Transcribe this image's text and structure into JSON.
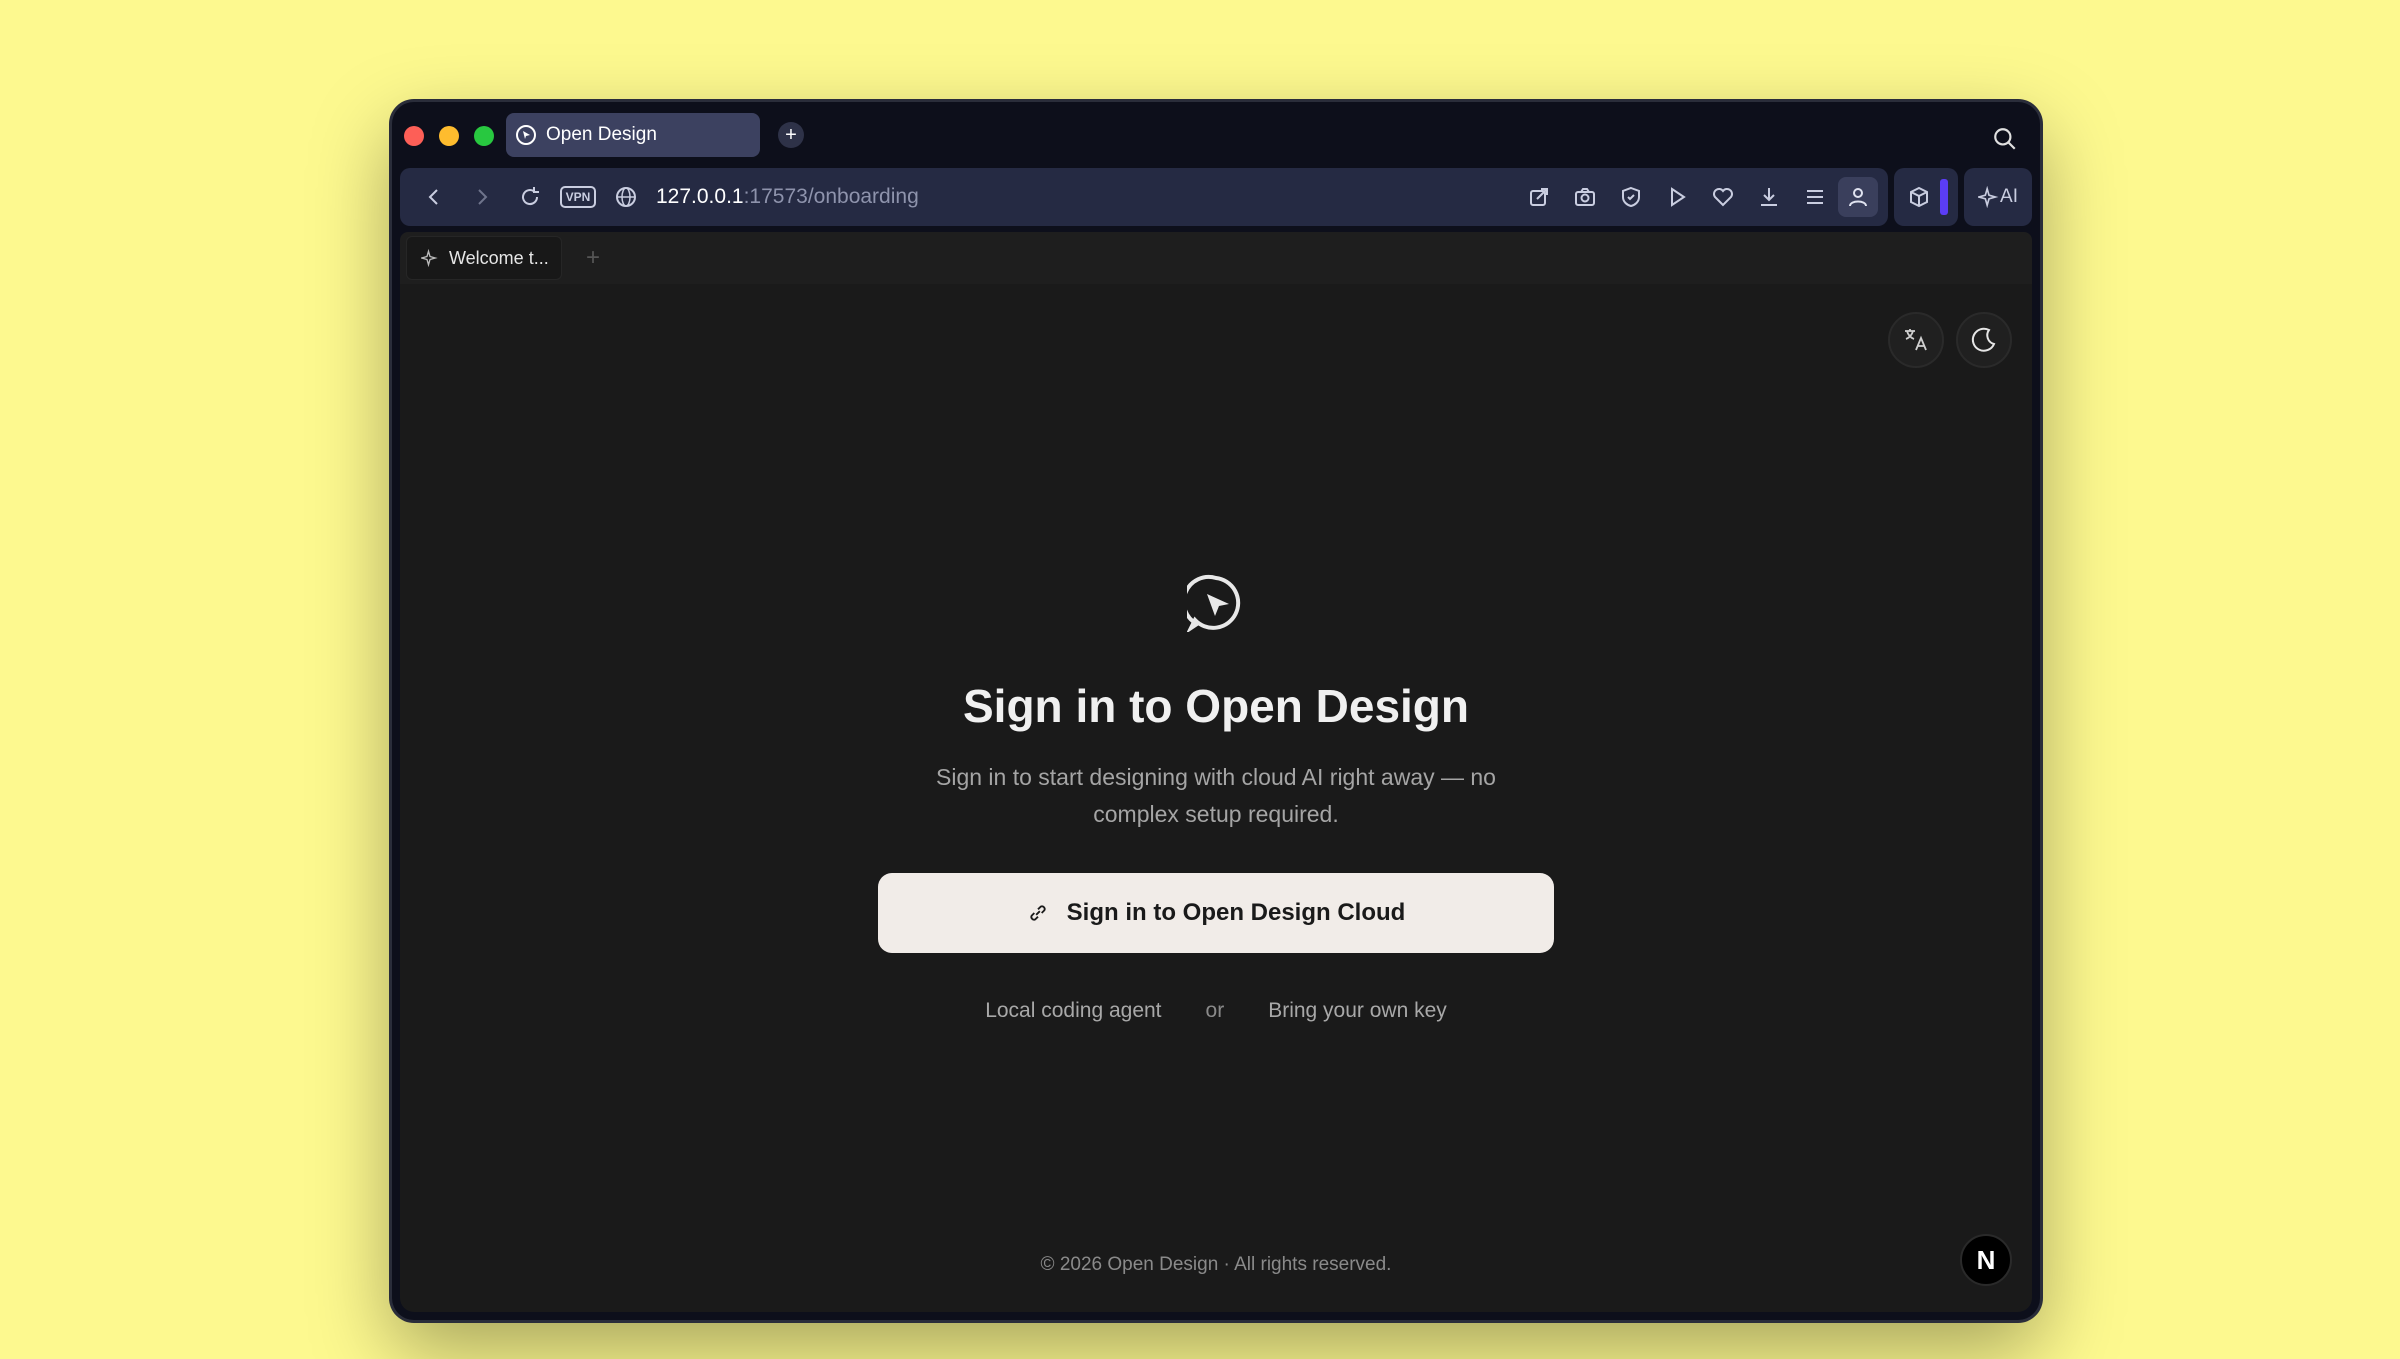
{
  "browser": {
    "tab_title": "Open Design",
    "url_host": "127.0.0.1",
    "url_path": ":17573/onboarding",
    "vpn_label": "VPN",
    "ai_label": "AI",
    "icons": [
      "back-icon",
      "forward-icon",
      "reload-icon",
      "globe-icon",
      "share-icon",
      "camera-icon",
      "shield-icon",
      "play-icon",
      "heart-icon",
      "download-icon",
      "menu-icon",
      "profile-icon",
      "cube-icon",
      "ai-sparkle-icon",
      "search-icon"
    ]
  },
  "inner_tab": {
    "label": "Welcome t...",
    "add_label": "+"
  },
  "onboarding": {
    "title": "Sign in to Open Design",
    "subtitle": "Sign in to start designing with cloud AI right away — no complex setup required.",
    "primary_button": "Sign in to Open Design Cloud",
    "alt_local": "Local coding agent",
    "alt_or": "or",
    "alt_byok": "Bring your own key",
    "footer": "© 2026 Open Design · All rights reserved.",
    "badge": "N"
  },
  "colors": {
    "background": "#fdf98f",
    "content_bg": "#1a1a1a",
    "button_bg": "#f1ece8",
    "accent": "#5b3df5"
  }
}
